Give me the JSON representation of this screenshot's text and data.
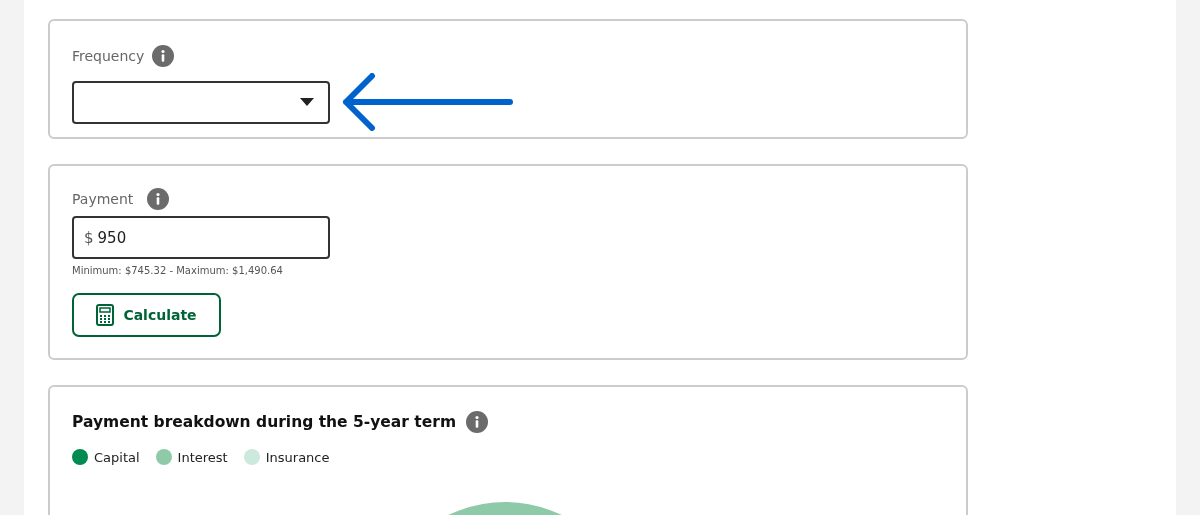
{
  "frequency": {
    "label": "Frequency"
  },
  "payment": {
    "label": "Payment",
    "currency": "$",
    "value": "950",
    "hint": "Minimum: $745.32 - Maximum: $1,490.64",
    "button": "Calculate"
  },
  "breakdown": {
    "title": "Payment breakdown during the 5-year term",
    "legend": [
      {
        "name": "Capital",
        "color": "#008c50"
      },
      {
        "name": "Interest",
        "color": "#8fcaa8"
      },
      {
        "name": "Insurance",
        "color": "#cde8dc"
      }
    ]
  }
}
